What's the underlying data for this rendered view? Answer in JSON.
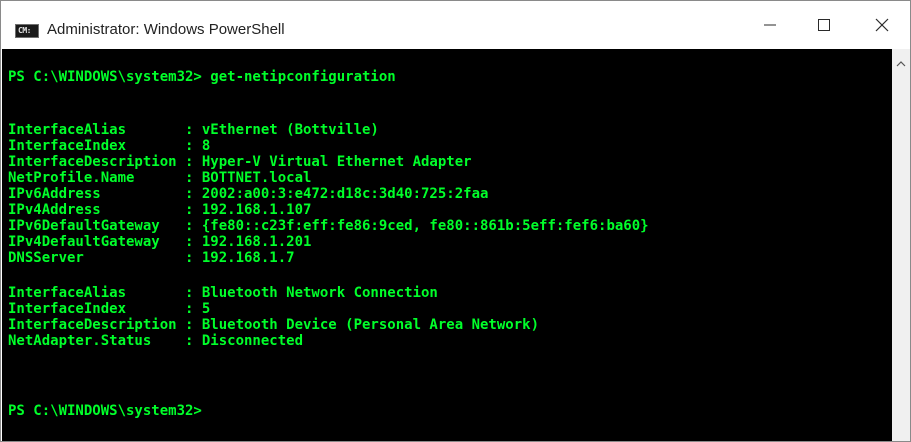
{
  "window": {
    "title": "Administrator: Windows PowerShell",
    "icon_label": "CM:"
  },
  "terminal": {
    "text_color": "#00ff2a",
    "background": "#000000",
    "lines": [
      {
        "text": "PS C:\\WINDOWS\\system32> get-netipconfiguration"
      },
      {
        "text": "InterfaceAlias       : vEthernet (Bottville)"
      },
      {
        "text": "InterfaceIndex       : 8"
      },
      {
        "text": "InterfaceDescription : Hyper-V Virtual Ethernet Adapter"
      },
      {
        "text": "NetProfile.Name      : BOTTNET.local"
      },
      {
        "text": "IPv6Address          : 2002:a00:3:e472:d18c:3d40:725:2faa"
      },
      {
        "text": "IPv4Address          : 192.168.1.107"
      },
      {
        "text": "IPv6DefaultGateway   : {fe80::c23f:eff:fe86:9ced, fe80::861b:5eff:fef6:ba60}"
      },
      {
        "text": "IPv4DefaultGateway   : 192.168.1.201"
      },
      {
        "text": "DNSServer            : 192.168.1.7"
      },
      {
        "text": "InterfaceAlias       : Bluetooth Network Connection"
      },
      {
        "text": "InterfaceIndex       : 5"
      },
      {
        "text": "InterfaceDescription : Bluetooth Device (Personal Area Network)"
      },
      {
        "text": "NetAdapter.Status    : Disconnected"
      },
      {
        "text": "PS C:\\WINDOWS\\system32>"
      }
    ]
  },
  "icons": {
    "minimize": "minimize-icon",
    "maximize": "maximize-icon",
    "close": "close-icon",
    "scroll_up": "chevron-up-icon"
  }
}
